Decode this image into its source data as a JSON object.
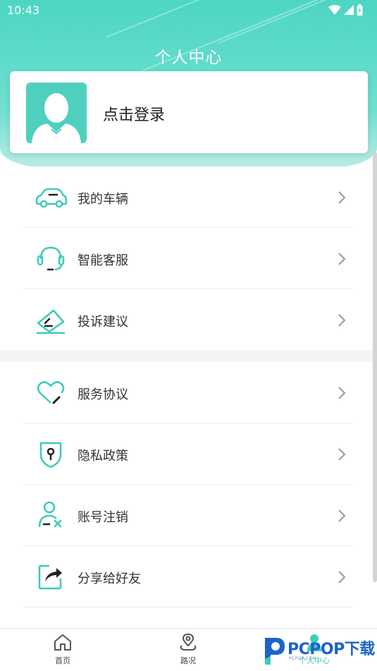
{
  "status_bar": {
    "time": "10:43"
  },
  "header": {
    "title": "个人中心"
  },
  "login": {
    "label": "点击登录"
  },
  "menu_group_1": [
    {
      "label": "我的车辆",
      "icon": "car-icon"
    },
    {
      "label": "智能客服",
      "icon": "headset-icon"
    },
    {
      "label": "投诉建议",
      "icon": "complaint-note-icon"
    }
  ],
  "menu_group_2": [
    {
      "label": "服务协议",
      "icon": "heart-pen-icon"
    },
    {
      "label": "隐私政策",
      "icon": "shield-lock-icon"
    },
    {
      "label": "账号注销",
      "icon": "user-remove-icon"
    },
    {
      "label": "分享给好友",
      "icon": "share-icon"
    }
  ],
  "bottom_nav": [
    {
      "label": "首页",
      "icon": "home-icon"
    },
    {
      "label": "路况",
      "icon": "road-condition-icon"
    },
    {
      "label": "个人中心",
      "icon": "profile-icon",
      "active": true
    }
  ],
  "watermark": {
    "brand": "PCPOP下载",
    "sub": "PCPOP.COM"
  },
  "colors": {
    "accent": "#4dd6c3",
    "nav_active": "#3ccdb9"
  }
}
